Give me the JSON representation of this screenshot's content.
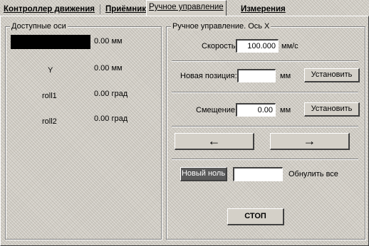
{
  "tabs": [
    {
      "label": "Контроллер движения"
    },
    {
      "label": "Приёмник"
    },
    {
      "label": "Ручное управление"
    },
    {
      "label": "Измерения"
    }
  ],
  "axes_panel": {
    "title": "Доступные оси",
    "axes": [
      {
        "name": "",
        "value": "0.00 мм"
      },
      {
        "name": "Y",
        "value": "0.00 мм"
      },
      {
        "name": "roll1",
        "value": "0.00 град"
      },
      {
        "name": "roll2",
        "value": "0.00 град"
      }
    ]
  },
  "manual_panel": {
    "title": "Ручное управление. Ось X",
    "speed_label": "Скорость:",
    "speed_value": "100.000",
    "speed_unit": "мм/с",
    "newpos_label": "Новая позиция:",
    "newpos_value": "",
    "newpos_unit": "мм",
    "newpos_button": "Установить",
    "offset_label": "Смещение:",
    "offset_value": "0.00",
    "offset_unit": "мм",
    "offset_button": "Установить",
    "left_arrow": "←",
    "right_arrow": "→",
    "zero_button": "Новый ноль",
    "zero_value": "",
    "reset_label": "Обнулить все",
    "stop_button": "СТОП"
  }
}
